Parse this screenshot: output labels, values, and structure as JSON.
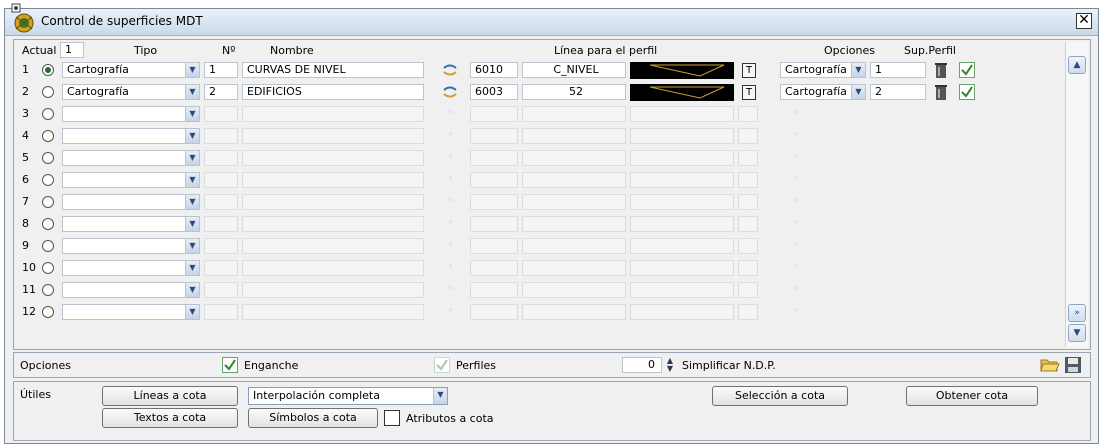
{
  "window": {
    "title": "Control de superficies MDT",
    "close_label": "✕"
  },
  "header": {
    "actual_label": "Actual",
    "actual_value": "1",
    "tipo": "Tipo",
    "num": "Nº",
    "nombre": "Nombre",
    "linea_perfil": "Línea para el perfil",
    "opciones": "Opciones",
    "sup_perfil": "Sup.Perfil"
  },
  "rows": [
    {
      "n": "1",
      "selected": true,
      "tipo": "Cartografía",
      "num": "1",
      "nombre": "CURVAS DE NIVEL",
      "code": "6010",
      "layer": "C_NIVEL",
      "t": "T",
      "opcion": "Cartografía",
      "sup": "1",
      "checked": true
    },
    {
      "n": "2",
      "selected": false,
      "tipo": "Cartografía",
      "num": "2",
      "nombre": "EDIFICIOS",
      "code": "6003",
      "layer": "52",
      "t": "T",
      "opcion": "Cartografía",
      "sup": "2",
      "checked": true
    },
    {
      "n": "3",
      "selected": false,
      "tipo": "",
      "num": "",
      "nombre": "",
      "code": "",
      "layer": ""
    },
    {
      "n": "4",
      "selected": false,
      "tipo": "",
      "num": "",
      "nombre": "",
      "code": "",
      "layer": ""
    },
    {
      "n": "5",
      "selected": false,
      "tipo": "",
      "num": "",
      "nombre": "",
      "code": "",
      "layer": ""
    },
    {
      "n": "6",
      "selected": false,
      "tipo": "",
      "num": "",
      "nombre": "",
      "code": "",
      "layer": ""
    },
    {
      "n": "7",
      "selected": false,
      "tipo": "",
      "num": "",
      "nombre": "",
      "code": "",
      "layer": ""
    },
    {
      "n": "8",
      "selected": false,
      "tipo": "",
      "num": "",
      "nombre": "",
      "code": "",
      "layer": ""
    },
    {
      "n": "9",
      "selected": false,
      "tipo": "",
      "num": "",
      "nombre": "",
      "code": "",
      "layer": ""
    },
    {
      "n": "10",
      "selected": false,
      "tipo": "",
      "num": "",
      "nombre": "",
      "code": "",
      "layer": ""
    },
    {
      "n": "11",
      "selected": false,
      "tipo": "",
      "num": "",
      "nombre": "",
      "code": "",
      "layer": ""
    },
    {
      "n": "12",
      "selected": false,
      "tipo": "",
      "num": "",
      "nombre": "",
      "code": "",
      "layer": ""
    }
  ],
  "options_bar": {
    "label": "Opciones",
    "enganche_label": "Enganche",
    "enganche_checked": true,
    "perfiles_label": "Perfiles",
    "perfiles_checked": true,
    "simplificar_value": "0",
    "simplificar_label": "Simplificar N.D.P."
  },
  "utiles": {
    "label": "Útiles",
    "lineas_btn": "Líneas a cota",
    "textos_btn": "Textos a cota",
    "interp_value": "Interpolación completa",
    "simbolos_btn": "Símbolos a cota",
    "atributos_label": "Atributos a cota",
    "seleccion_btn": "Selección a cota",
    "obtener_btn": "Obtener cota"
  },
  "colors": {
    "check_green": "#2a8a2a",
    "line_yellow": "#c8a030"
  }
}
